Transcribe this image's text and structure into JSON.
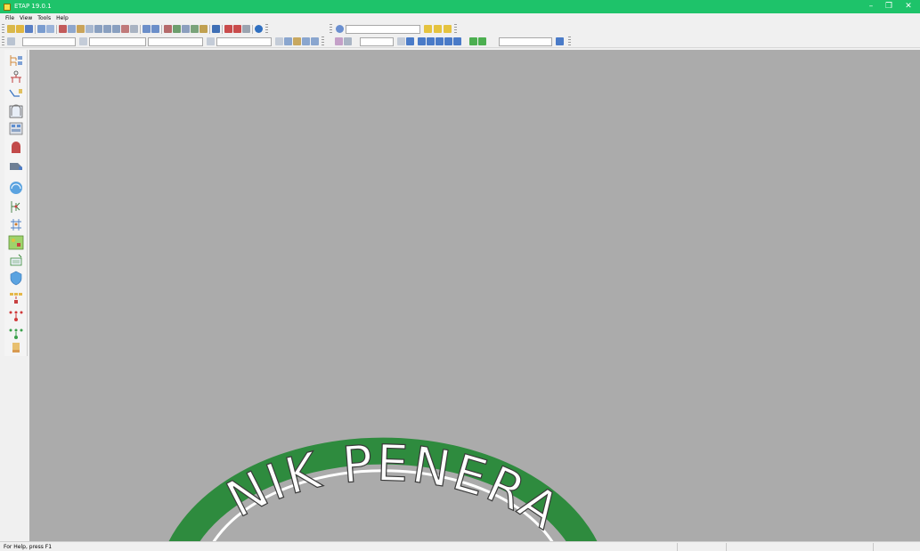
{
  "window": {
    "title": "ETAP 19.0.1",
    "controls": {
      "minimize": "–",
      "restore": "❐",
      "close": "✕"
    }
  },
  "menu": {
    "items": [
      "File",
      "View",
      "Tools",
      "Help"
    ]
  },
  "left_palette": {
    "tools": [
      "network-tree-icon",
      "one-line-icon",
      "underground-raceway-icon",
      "ground-grid-icon",
      "panel-system-icon",
      "cable-pulling-icon",
      "cable-icon",
      "dashboard-icon",
      "star-tcc-icon",
      "sequence-icon",
      "geographic-view-icon",
      "control-circuit-icon",
      "shield-icon",
      "logic-block-icon",
      "protection-sequence-icon",
      "scenario-icon",
      "study-wizard-icon"
    ]
  },
  "watermark": {
    "text": "NIK PENERA"
  },
  "status": {
    "help_text": "For Help, press F1"
  },
  "colors": {
    "titlebar": "#1ec36a",
    "canvas": "#ababab",
    "watermark_ring": "#2e8b3e",
    "watermark_text": "#ffffff"
  }
}
